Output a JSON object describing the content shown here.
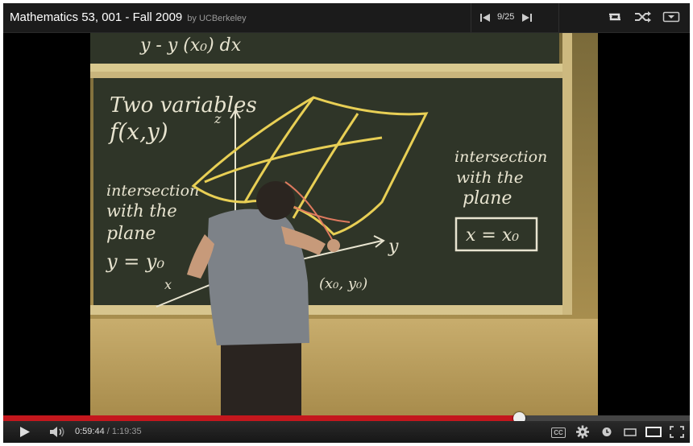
{
  "header": {
    "title": "Mathematics 53, 001 - Fall 2009",
    "byline": "by UCBerkeley",
    "playlist_position": "9/25"
  },
  "top_icons": [
    "loop-icon",
    "shuffle-icon",
    "dropdown-icon"
  ],
  "video": {
    "board_text": {
      "top_fragment": "y - y (x₀) dx",
      "heading_line1": "Two variables",
      "heading_line2": "f(x,y)",
      "axis_z": "z",
      "axis_y": "y",
      "axis_x": "x",
      "left_note_line1": "intersection",
      "left_note_line2": "with the",
      "left_note_line3": "plane",
      "left_note_line4": "y = y₀",
      "right_note_line1": "intersection",
      "right_note_line2": "with the",
      "right_note_line3": "plane",
      "right_note_box": "x = x₀",
      "point_label": "(x₀, y₀)"
    }
  },
  "player": {
    "progress_fraction": 0.7506,
    "loaded_end_fraction": 0.755,
    "current_time": "0:59:44",
    "separator": " / ",
    "duration": "1:19:35",
    "cc_label": "CC"
  },
  "colors": {
    "played": "#c4171d",
    "chalk_yellow": "#e8cf55",
    "board": "#2f3528"
  }
}
